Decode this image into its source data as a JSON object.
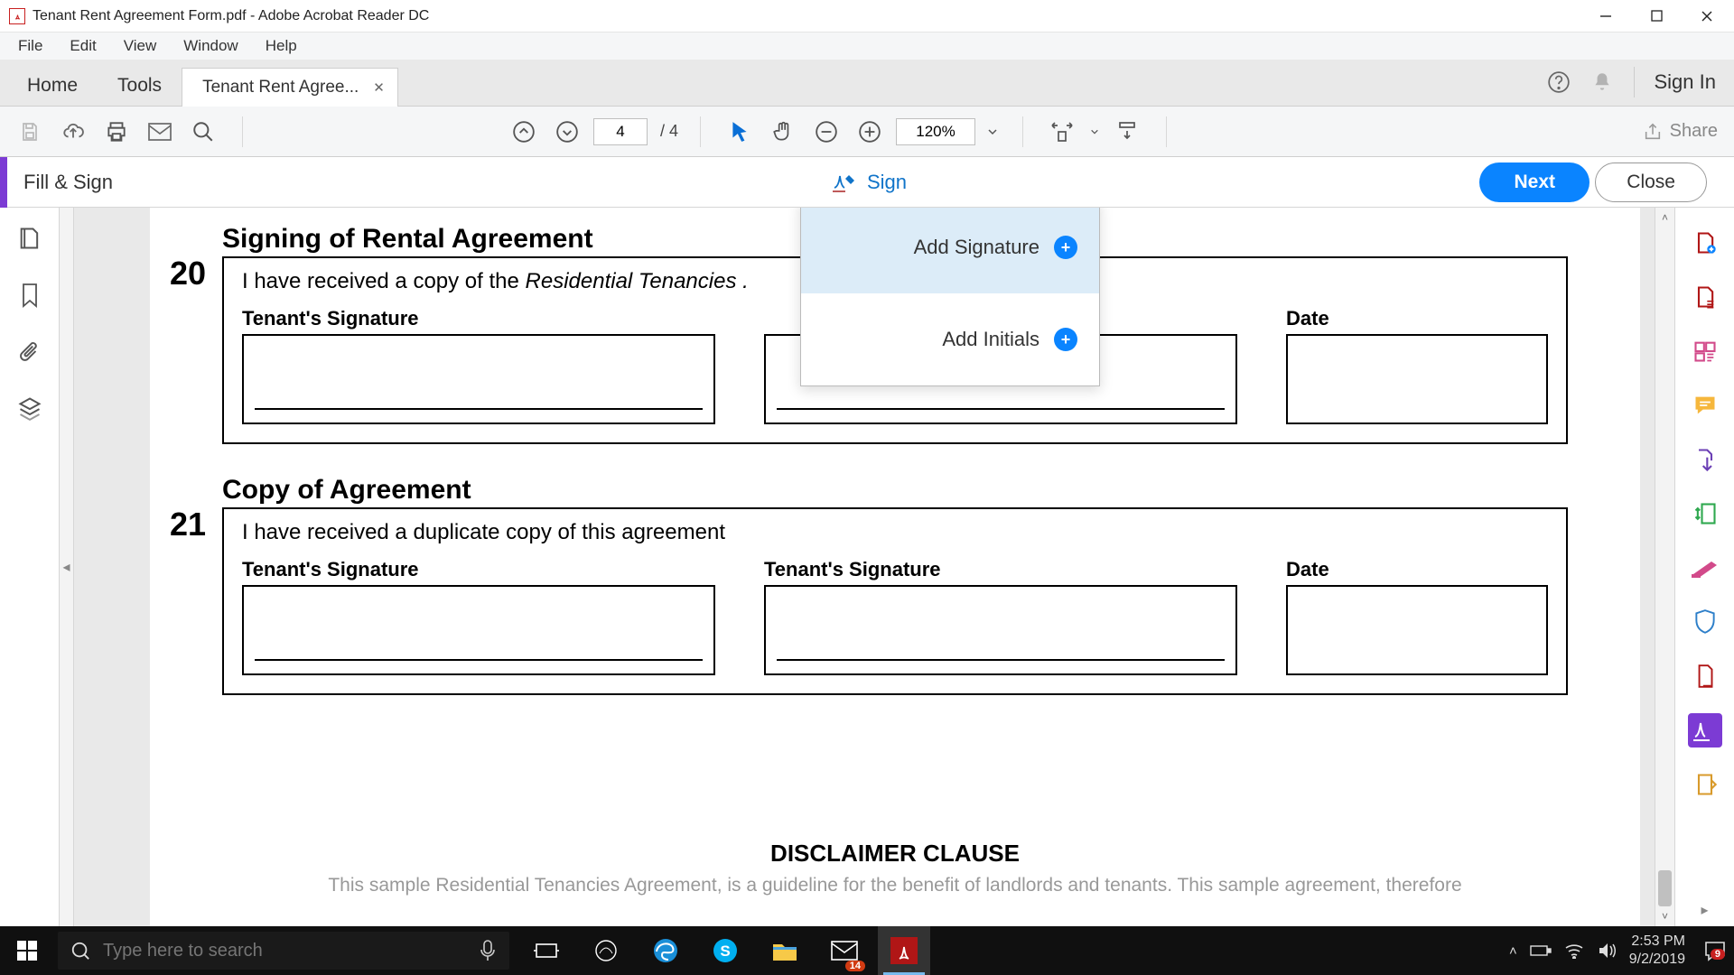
{
  "titlebar": {
    "title": "Tenant Rent Agreement Form.pdf - Adobe Acrobat Reader DC"
  },
  "menubar": {
    "items": [
      "File",
      "Edit",
      "View",
      "Window",
      "Help"
    ]
  },
  "tabs": {
    "home": "Home",
    "tools": "Tools",
    "doc": "Tenant Rent Agree..."
  },
  "tabright": {
    "signin": "Sign In"
  },
  "toolbar": {
    "page_current": "4",
    "page_total": "/ 4",
    "zoom": "120%",
    "share": "Share"
  },
  "fsbar": {
    "title": "Fill & Sign",
    "sign": "Sign",
    "next": "Next",
    "close": "Close"
  },
  "popover": {
    "add_signature": "Add Signature",
    "add_initials": "Add Initials"
  },
  "doc": {
    "s20_num": "20",
    "s20_title": "Signing of Rental Agreement",
    "s20_body_a": "I have received a copy of the ",
    "s20_body_b": "Residential Tenancies .",
    "s20_sig1": "Tenant's Signature",
    "s20_date": "Date",
    "s21_num": "21",
    "s21_title": "Copy of Agreement",
    "s21_body": "I have received a duplicate copy of this agreement",
    "s21_sig1": "Tenant's Signature",
    "s21_sig2": "Tenant's Signature",
    "s21_date": "Date",
    "disclaimer_h": "DISCLAIMER CLAUSE",
    "disclaimer_b": "This sample Residential Tenancies Agreement, is a guideline for the benefit of landlords and tenants. This sample agreement, therefore"
  },
  "taskbar": {
    "search_placeholder": "Type here to search",
    "mail_badge": "14",
    "time": "2:53 PM",
    "date": "9/2/2019",
    "notif_badge": "9"
  }
}
